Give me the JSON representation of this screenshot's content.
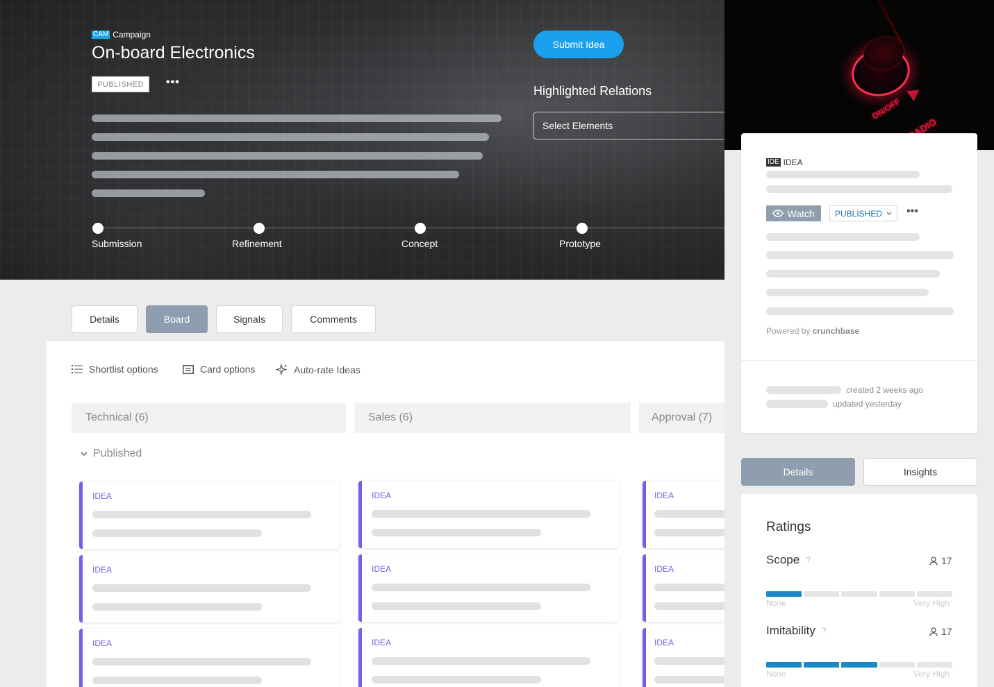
{
  "campaign": {
    "tag": "CAM",
    "type_label": "Campaign",
    "title": "On-board Electronics",
    "status": "PUBLISHED",
    "more": "•••"
  },
  "actions": {
    "submit_label": "Submit Idea"
  },
  "relations": {
    "title": "Highlighted Relations",
    "select_placeholder": "Select Elements"
  },
  "phases": [
    "Submission",
    "Refinement",
    "Concept",
    "Prototype"
  ],
  "tabs": [
    {
      "label": "Details",
      "active": false
    },
    {
      "label": "Board",
      "active": true
    },
    {
      "label": "Signals",
      "active": false
    },
    {
      "label": "Comments",
      "active": false
    }
  ],
  "toolbar": {
    "shortlist": "Shortlist options",
    "card": "Card options",
    "autorate": "Auto-rate Ideas"
  },
  "columns": [
    {
      "label": "Technical (6)"
    },
    {
      "label": "Sales (6)"
    },
    {
      "label": "Approval (7)"
    }
  ],
  "group": {
    "label": "Published"
  },
  "card_label": "IDEA",
  "radio_image": {
    "text1": "ON/OFF",
    "text2": "RADIO"
  },
  "idea_panel": {
    "tag": "IDE",
    "type_label": "IDEA",
    "watch_label": "Watch",
    "status": "PUBLISHED",
    "more": "•••",
    "powered_prefix": "Powered by",
    "powered_brand": "crunchbase",
    "created": "created 2 weeks ago",
    "updated": "updated yesterday"
  },
  "right_tabs": [
    {
      "label": "Details",
      "active": true
    },
    {
      "label": "Insights",
      "active": false
    }
  ],
  "ratings": {
    "title": "Ratings",
    "criteria": [
      {
        "name": "Scope",
        "help": "?",
        "count": "17",
        "filled_segments": 1,
        "total_segments": 5
      },
      {
        "name": "Imitability",
        "help": "?",
        "count": "17",
        "filled_segments": 3,
        "total_segments": 5
      }
    ],
    "scale_low": "None",
    "scale_high": "Very High"
  },
  "icons": {
    "more": "more-horizontal-icon",
    "watch": "eye-icon",
    "dropdown": "chevron-down-icon",
    "group_toggle": "chevron-down-icon",
    "shortlist": "list-icon",
    "card": "card-icon",
    "autorate": "sparkle-icon",
    "rating_count": "user-icon"
  },
  "colors": {
    "accent_blue": "#1aa0ec",
    "idea_purple": "#7a5ce6",
    "active_tab": "#8f9eae",
    "rating_bar": "#1a8ac6",
    "status_blue": "#1a6fb0"
  }
}
